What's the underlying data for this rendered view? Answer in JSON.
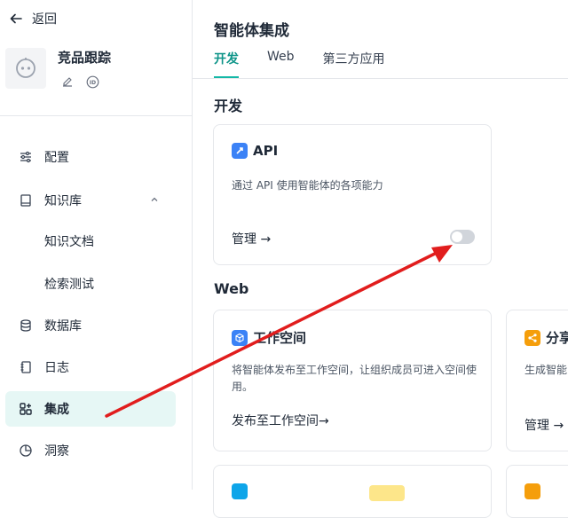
{
  "sidebar": {
    "back_label": "返回",
    "agent_name": "竞品跟踪",
    "items": [
      {
        "label": "配置",
        "icon": "sliders-icon"
      },
      {
        "label": "知识库",
        "icon": "book-icon"
      },
      {
        "label": "知识文档"
      },
      {
        "label": "检索测试"
      },
      {
        "label": "数据库",
        "icon": "database-icon"
      },
      {
        "label": "日志",
        "icon": "log-icon"
      },
      {
        "label": "集成",
        "icon": "grid-plus-icon"
      },
      {
        "label": "洞察",
        "icon": "pie-chart-icon"
      }
    ]
  },
  "main": {
    "title": "智能体集成",
    "tabs": [
      "开发",
      "Web",
      "第三方应用"
    ],
    "dev_section": "开发",
    "web_section": "Web",
    "api_card": {
      "title": "API",
      "desc": "通过 API 使用智能体的各项能力",
      "link": "管理 →",
      "enabled": false
    },
    "workspace_card": {
      "title": "工作空间",
      "desc": "将智能体发布至工作空间，让组织成员可进入空间使用。",
      "link": "发布至工作空间→"
    },
    "share_card": {
      "title": "分享",
      "desc": "生成智能",
      "link": "管理 →"
    }
  },
  "colors": {
    "accent": "#14b8a6",
    "active_bg": "#e6f7f5",
    "arrow": "#e11d1d"
  }
}
